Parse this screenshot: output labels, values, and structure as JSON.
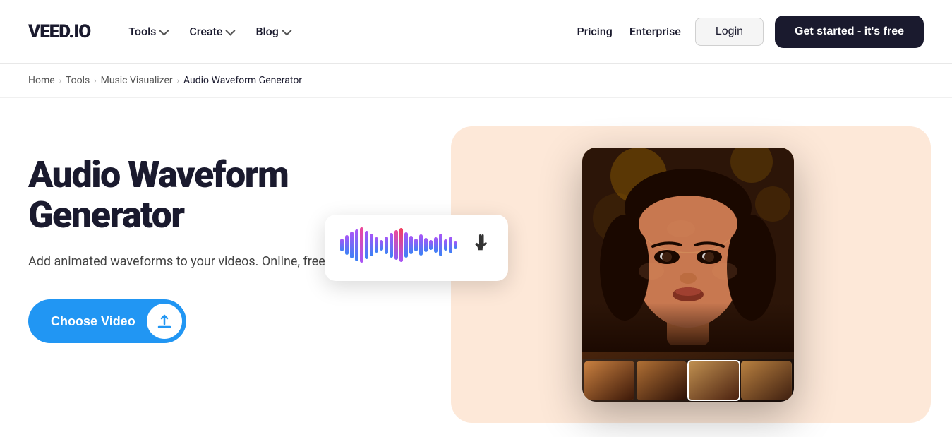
{
  "header": {
    "logo": "VEED.IO",
    "nav_left": [
      {
        "label": "Tools",
        "has_dropdown": true
      },
      {
        "label": "Create",
        "has_dropdown": true
      },
      {
        "label": "Blog",
        "has_dropdown": true
      }
    ],
    "nav_right": [
      {
        "label": "Pricing",
        "key": "pricing"
      },
      {
        "label": "Enterprise",
        "key": "enterprise"
      }
    ],
    "login_label": "Login",
    "cta_label": "Get started - it's free"
  },
  "breadcrumb": {
    "items": [
      "Home",
      "Tools",
      "Music Visualizer",
      "Audio Waveform Generator"
    ],
    "separators": [
      "›",
      "›",
      "›"
    ]
  },
  "hero": {
    "title": "Audio Waveform Generator",
    "subtitle": "Add animated waveforms to your videos. Online, free",
    "cta_label": "Choose Video"
  },
  "waveform_card": {
    "cursor": "👆"
  },
  "icons": {
    "upload": "↑",
    "play": "▶",
    "pause": "⏸"
  }
}
